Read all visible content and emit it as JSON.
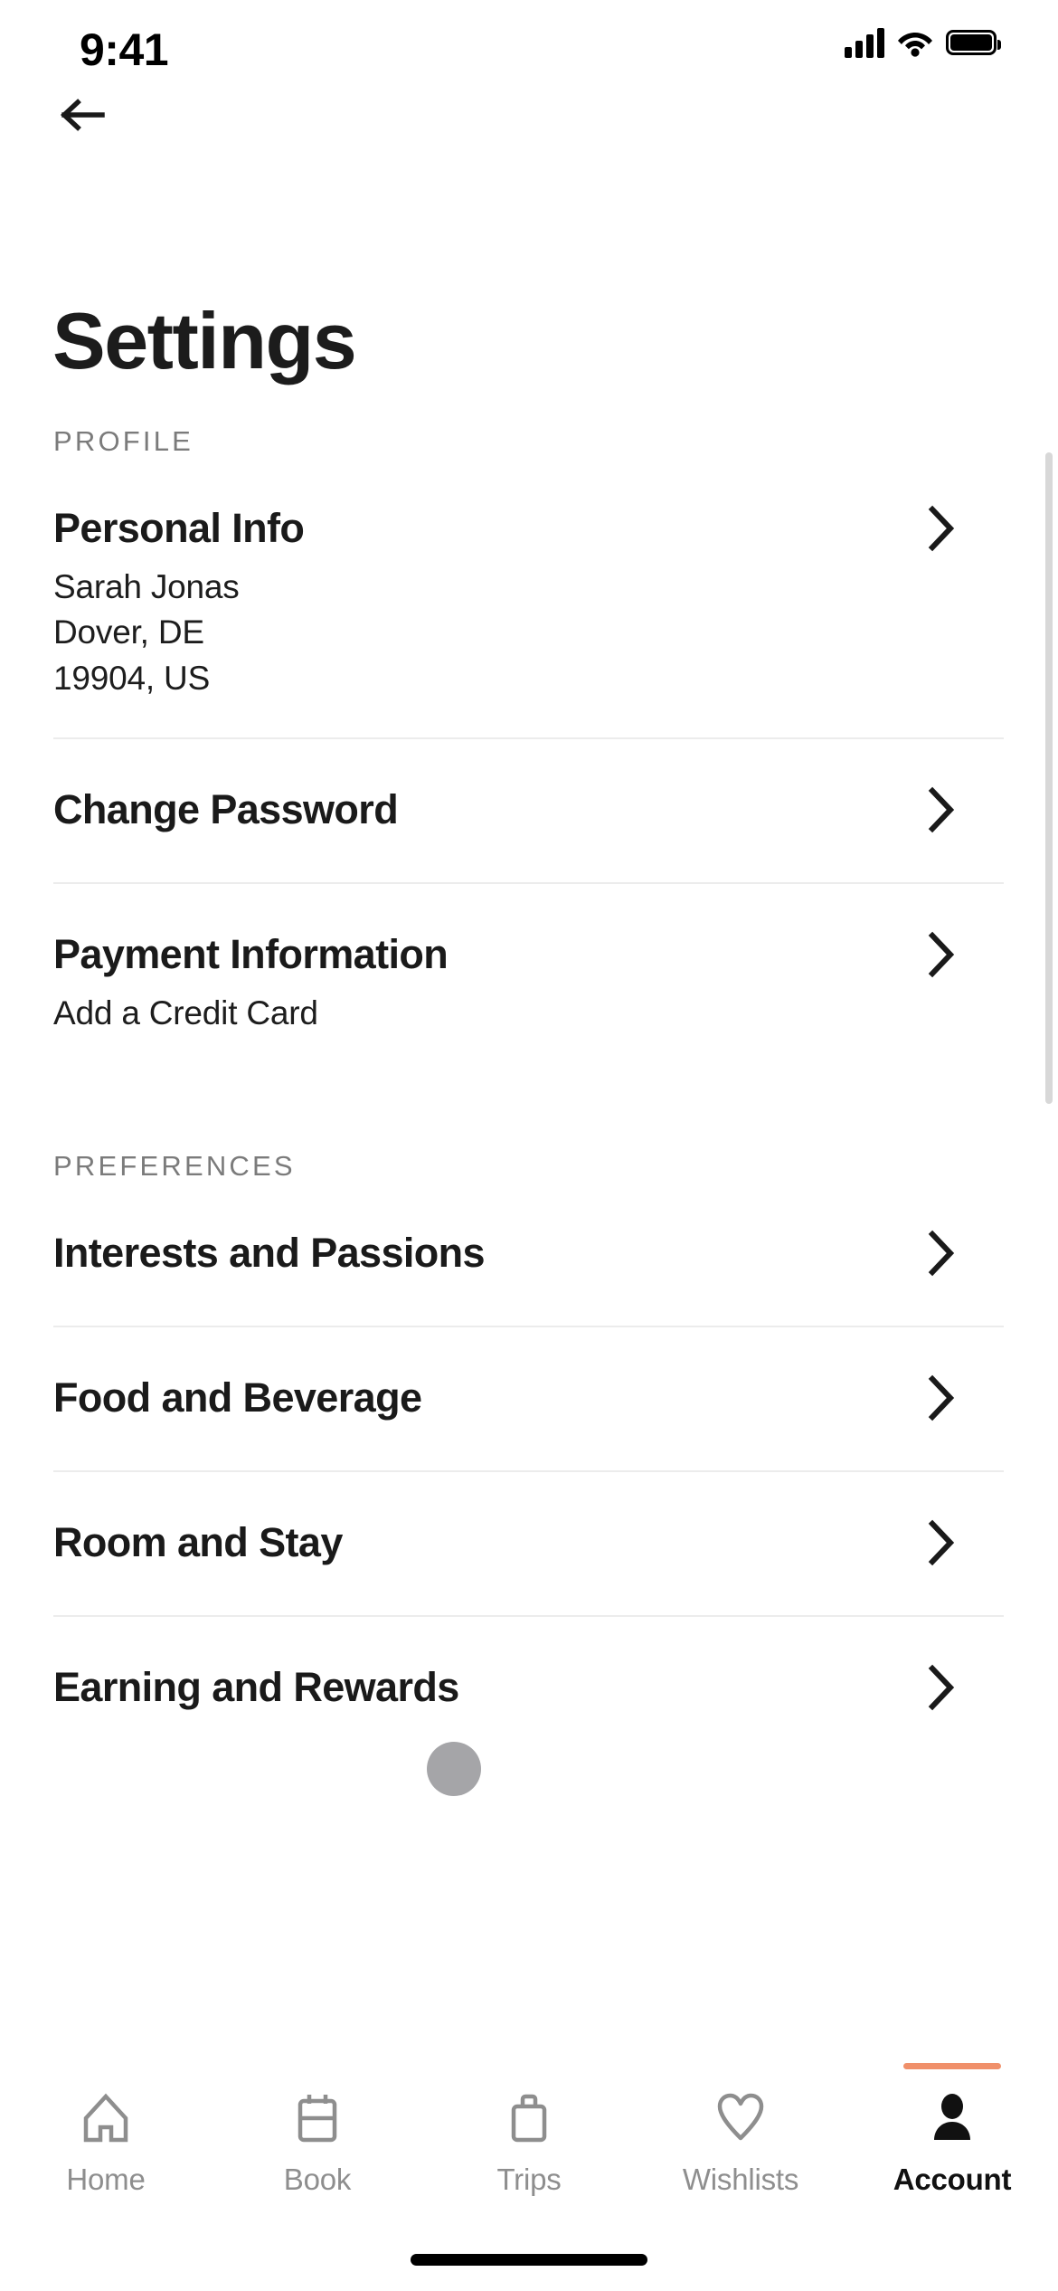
{
  "status_bar": {
    "time": "9:41",
    "cellular_icon": "signal-bars-icon",
    "wifi_icon": "wifi-icon",
    "battery_icon": "battery-full-icon"
  },
  "nav": {
    "back_icon": "back-arrow-icon"
  },
  "header": {
    "title": "Settings"
  },
  "sections": [
    {
      "label": "PROFILE",
      "rows": [
        {
          "title": "Personal Info",
          "chevron": "chevron-right-icon",
          "sub_lines": [
            "Sarah Jonas",
            "Dover, DE",
            "19904, US"
          ]
        },
        {
          "title": "Change Password",
          "chevron": "chevron-right-icon",
          "sub_lines": []
        },
        {
          "title": "Payment Information",
          "chevron": "chevron-right-icon",
          "sub_lines": [
            "Add a Credit Card"
          ]
        }
      ]
    },
    {
      "label": "PREFERENCES",
      "rows": [
        {
          "title": "Interests and Passions",
          "chevron": "chevron-right-icon",
          "sub_lines": []
        },
        {
          "title": "Food and Beverage",
          "chevron": "chevron-right-icon",
          "sub_lines": []
        },
        {
          "title": "Room and Stay",
          "chevron": "chevron-right-icon",
          "sub_lines": []
        },
        {
          "title": "Earning and Rewards",
          "chevron": "chevron-right-icon",
          "sub_lines": []
        }
      ]
    }
  ],
  "tabbar": {
    "items": [
      {
        "label": "Home",
        "icon": "home-icon",
        "active": false
      },
      {
        "label": "Book",
        "icon": "book-icon",
        "active": false
      },
      {
        "label": "Trips",
        "icon": "briefcase-icon",
        "active": false
      },
      {
        "label": "Wishlists",
        "icon": "heart-icon",
        "active": false
      },
      {
        "label": "Account",
        "icon": "person-icon",
        "active": true
      }
    ],
    "active_indicator_color": "#F0906A"
  },
  "cursor": {
    "name": "touch-pointer-dot",
    "color": "#A5A5A8"
  },
  "colors": {
    "accent": "#F0906A",
    "text_primary": "#1A1A1A",
    "text_secondary": "#7B7B7B",
    "divider": "#ECECEC",
    "background": "#FFFFFF"
  }
}
